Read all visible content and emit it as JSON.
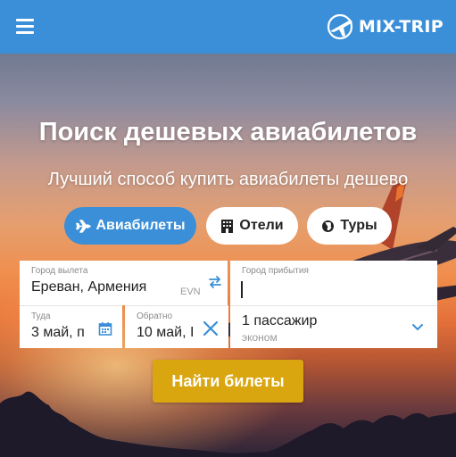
{
  "header": {
    "logo_text": "MIX-TRIP",
    "accent_color": "#3a8fd8",
    "menu_icon": "hamburger-menu-icon",
    "logo_icon": "globe-plane-logo"
  },
  "hero": {
    "title": "Поиск дешевых авиабилетов",
    "subtitle": "Лучший способ купить авиабилеты дешево"
  },
  "tabs": [
    {
      "label": "Авиабилеты",
      "icon": "airplane-icon",
      "active": true
    },
    {
      "label": "Отели",
      "icon": "hotel-icon",
      "active": false
    },
    {
      "label": "Туры",
      "icon": "globe-icon",
      "active": false
    }
  ],
  "form": {
    "from": {
      "label": "Город вылета",
      "value": "Ереван, Армения",
      "code": "EVN"
    },
    "to": {
      "label": "Город прибытия",
      "value": ""
    },
    "depart": {
      "label": "Туда",
      "value": "3 май, п"
    },
    "return": {
      "label": "Обратно",
      "value": "10 май, I"
    },
    "passengers": {
      "value": "1 пассажир",
      "class": "эконом"
    }
  },
  "search_button": {
    "label": "Найти билеты",
    "color": "#d9a610"
  }
}
